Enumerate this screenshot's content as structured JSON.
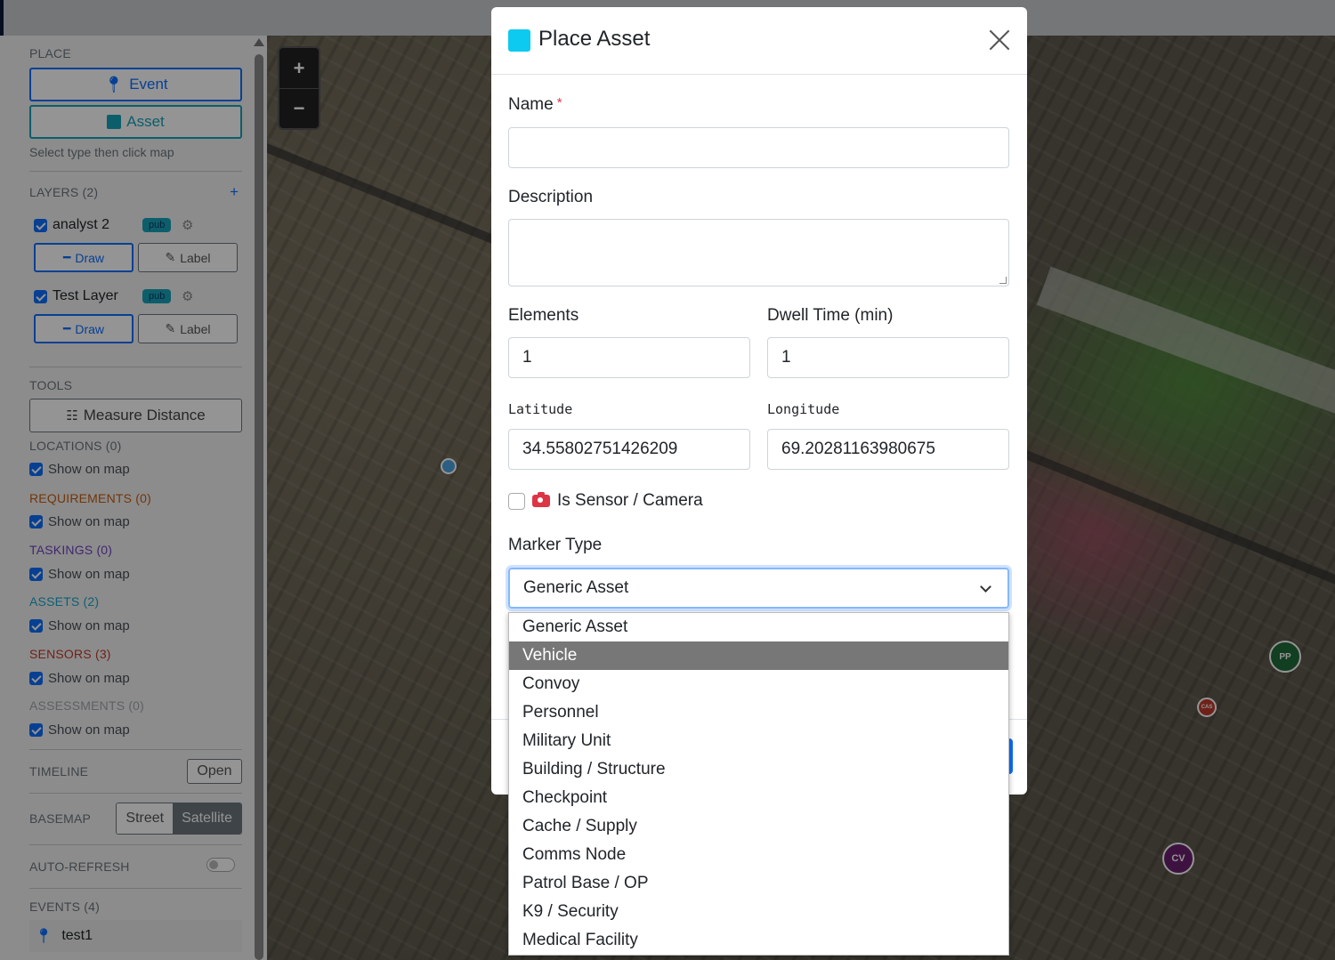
{
  "sidebar": {
    "place": {
      "label": "PLACE",
      "event_button": "Event",
      "asset_button": "Asset",
      "hint": "Select type then click map"
    },
    "layers": {
      "label": "LAYERS (2)",
      "add_icon": "+",
      "items": [
        {
          "name": "analyst 2",
          "badge": "pub",
          "draw": "Draw",
          "label": "Label"
        },
        {
          "name": "Test Layer",
          "badge": "pub",
          "draw": "Draw",
          "label": "Label"
        }
      ]
    },
    "tools": {
      "label": "TOOLS",
      "measure_button": "Measure Distance"
    },
    "sections": [
      {
        "label": "LOCATIONS (0)",
        "show": "Show on map"
      },
      {
        "label": "REQUIREMENTS (0)",
        "show": "Show on map"
      },
      {
        "label": "TASKINGS (0)",
        "show": "Show on map"
      },
      {
        "label": "ASSETS (2)",
        "show": "Show on map"
      },
      {
        "label": "SENSORS (3)",
        "show": "Show on map"
      },
      {
        "label": "ASSESSMENTS (0)",
        "show": "Show on map"
      }
    ],
    "timeline": {
      "label": "TIMELINE",
      "button": "Open"
    },
    "basemap": {
      "label": "BASEMAP",
      "options": [
        "Street",
        "Satellite"
      ],
      "selected": "Satellite"
    },
    "autorefresh": {
      "label": "AUTO-REFRESH",
      "enabled": false
    },
    "events": {
      "label": "EVENTS (4)",
      "items": [
        "test1"
      ]
    }
  },
  "map": {
    "zoom_in": "+",
    "zoom_out": "−",
    "markers": [
      "PP",
      "CAS",
      "CV"
    ]
  },
  "modal": {
    "title": "Place Asset",
    "name_label": "Name",
    "required_mark": "*",
    "name_value": "",
    "description_label": "Description",
    "description_value": "",
    "elements_label": "Elements",
    "elements_value": "1",
    "dwell_label": "Dwell Time (min)",
    "dwell_value": "1",
    "latitude_label": "Latitude",
    "latitude_value": "34.55802751426209",
    "longitude_label": "Longitude",
    "longitude_value": "69.20281163980675",
    "sensor_label": "Is Sensor / Camera",
    "sensor_checked": false,
    "marker_type_label": "Marker Type",
    "marker_type_value": "Generic Asset"
  },
  "dropdown": {
    "options": [
      "Generic Asset",
      "Vehicle",
      "Convoy",
      "Personnel",
      "Military Unit",
      "Building / Structure",
      "Checkpoint",
      "Cache / Supply",
      "Comms Node",
      "Patrol Base / OP",
      "K9 / Security",
      "Medical Facility"
    ],
    "highlighted": "Vehicle"
  },
  "colors": {
    "primary": "#0d6efd",
    "info": "#17a2b8",
    "asset_square": "#0dcaf0",
    "danger": "#dc3545"
  }
}
